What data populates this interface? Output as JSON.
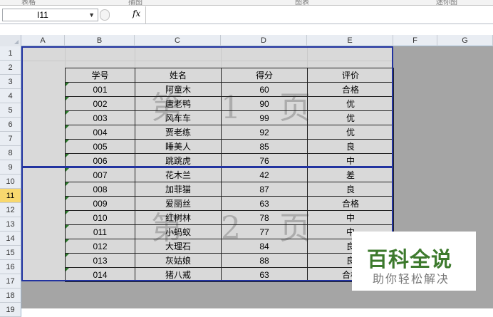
{
  "ribbon": {
    "groups": [
      "表格",
      "插图",
      "图表",
      "迷你图"
    ]
  },
  "formula_bar": {
    "cell_ref": "I11",
    "fx_label": "fx",
    "value": ""
  },
  "columns": [
    "A",
    "B",
    "C",
    "D",
    "E",
    "F",
    "G"
  ],
  "rows": [
    "1",
    "2",
    "3",
    "4",
    "5",
    "6",
    "7",
    "8",
    "9",
    "10",
    "11",
    "12",
    "13",
    "14",
    "15",
    "16",
    "17",
    "18",
    "19"
  ],
  "selected_row": "11",
  "table": {
    "header": [
      "学号",
      "姓名",
      "得分",
      "评价"
    ],
    "rows": [
      [
        "001",
        "阿童木",
        "60",
        "合格"
      ],
      [
        "002",
        "唐老鸭",
        "90",
        "优"
      ],
      [
        "003",
        "风车车",
        "99",
        "优"
      ],
      [
        "004",
        "贾老练",
        "92",
        "优"
      ],
      [
        "005",
        "睡美人",
        "85",
        "良"
      ],
      [
        "006",
        "跳跳虎",
        "76",
        "中"
      ],
      [
        "007",
        "花木兰",
        "42",
        "差"
      ],
      [
        "008",
        "加菲猫",
        "87",
        "良"
      ],
      [
        "009",
        "爱丽丝",
        "63",
        "合格"
      ],
      [
        "010",
        "红树林",
        "78",
        "中"
      ],
      [
        "011",
        "小蚂蚁",
        "77",
        "中"
      ],
      [
        "012",
        "大理石",
        "84",
        "良"
      ],
      [
        "013",
        "灰姑娘",
        "88",
        "良"
      ],
      [
        "014",
        "猪八戒",
        "63",
        "合格"
      ]
    ]
  },
  "watermarks": {
    "page1": "第 1 页",
    "page2": "第 2 页"
  },
  "logo": {
    "title": "百科全说",
    "subtitle": "助你轻松解决"
  },
  "colors": {
    "page_break": "#2233a0",
    "outside_area": "#a5a5a5",
    "page_area": "#d9d9d9",
    "logo_green": "#3d7a2d"
  }
}
